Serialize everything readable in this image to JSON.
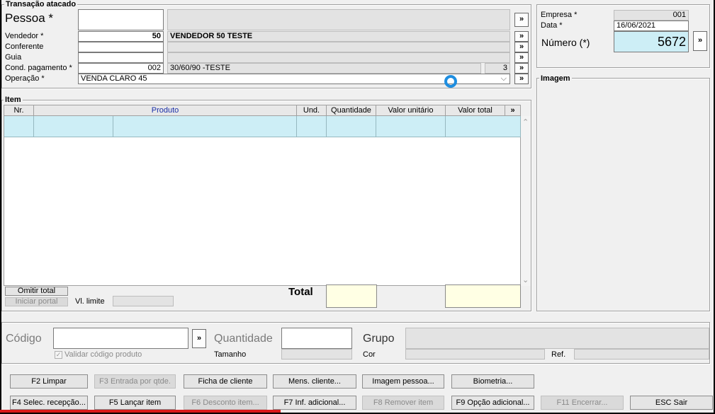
{
  "header": {
    "group_title": "Transação atacado",
    "pessoa": {
      "label": "Pessoa *",
      "code": "",
      "name": ""
    },
    "vendedor": {
      "label": "Vendedor *",
      "code": "50",
      "name": "VENDEDOR 50 TESTE"
    },
    "conferente": {
      "label": "Conferente",
      "code": "",
      "name": ""
    },
    "guia": {
      "label": "Guia",
      "code": "",
      "name": ""
    },
    "cond_pagamento": {
      "label": "Cond. pagamento *",
      "code": "002",
      "name": "30/60/90 -TESTE",
      "parcelas": "3"
    },
    "operacao": {
      "label": "Operação *",
      "value": "VENDA CLARO 45"
    },
    "more_glyph": "»",
    "dropdown_glyph": "⌵"
  },
  "empresa": {
    "empresa_label": "Empresa *",
    "empresa_value": "001",
    "data_label": "Data *",
    "data_value": "16/06/2021",
    "numero_label": "Número (*)",
    "numero_value": "5672"
  },
  "imagem": {
    "title": "Imagem"
  },
  "item": {
    "group_title": "Item",
    "columns": [
      "Nr.",
      "Produto",
      "Und.",
      "Quantidade",
      "Valor unitário",
      "Valor total",
      "»"
    ],
    "omitir_total": "Omitir total",
    "iniciar_portal": "Iniciar portal",
    "vl_limite_label": "Vl. limite",
    "total_label": "Total",
    "scroll_up": "⌃",
    "scroll_down": "⌄"
  },
  "entry": {
    "codigo_label": "Código",
    "quantidade_label": "Quantidade",
    "grupo_label": "Grupo",
    "validar_label": "Validar código produto",
    "tamanho_label": "Tamanho",
    "cor_label": "Cor",
    "ref_label": "Ref."
  },
  "buttons_row1": [
    {
      "label": "F2 Limpar",
      "enabled": true
    },
    {
      "label": "F3 Entrada por qtde.",
      "enabled": false
    },
    {
      "label": "Ficha de cliente",
      "enabled": true
    },
    {
      "label": "Mens. cliente...",
      "enabled": true
    },
    {
      "label": "Imagem pessoa...",
      "enabled": true
    },
    {
      "label": "Biometria...",
      "enabled": true
    }
  ],
  "buttons_row2": [
    {
      "label": "F4 Selec. recepção...",
      "enabled": true
    },
    {
      "label": "F5 Lançar item",
      "enabled": true
    },
    {
      "label": "F6 Desconto item...",
      "enabled": false
    },
    {
      "label": "F7 Inf. adicional...",
      "enabled": true
    },
    {
      "label": "F8 Remover item",
      "enabled": false
    },
    {
      "label": "F9 Opção adicional...",
      "enabled": true
    },
    {
      "label": "F11 Encerrar...",
      "enabled": false
    },
    {
      "label": "ESC Sair",
      "enabled": true
    }
  ],
  "colors": {
    "grid_selection": "#cdeef6",
    "numero_bg": "#cdeef6",
    "total_bg": "#ffffe4",
    "accent_bar": "#d9191a",
    "cursor_ring": "#1e8ee0"
  }
}
